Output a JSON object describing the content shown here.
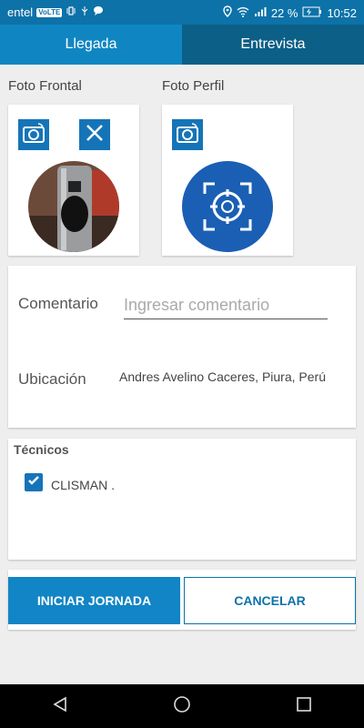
{
  "colors": {
    "primary": "#0c72a8",
    "tab_active": "#0f86c2",
    "tab_inactive": "#0c5f86",
    "accent": "#1185c5"
  },
  "status_bar": {
    "carrier": "entel",
    "volte": "VoLTE",
    "battery": "22 %",
    "time": "10:52"
  },
  "tabs": [
    {
      "label": "Llegada",
      "active": true
    },
    {
      "label": "Entrevista",
      "active": false
    }
  ],
  "photos": {
    "front_label": "Foto Frontal",
    "profile_label": "Foto Perfil"
  },
  "form": {
    "comment_label": "Comentario",
    "comment_placeholder": "Ingresar comentario",
    "location_label": "Ubicación",
    "location_value": "Andres Avelino Caceres, Piura, Perú"
  },
  "technicians": {
    "title": "Técnicos",
    "items": [
      {
        "name": "CLISMAN .",
        "checked": true
      }
    ]
  },
  "buttons": {
    "start": "INICIAR JORNADA",
    "cancel": "CANCELAR"
  }
}
